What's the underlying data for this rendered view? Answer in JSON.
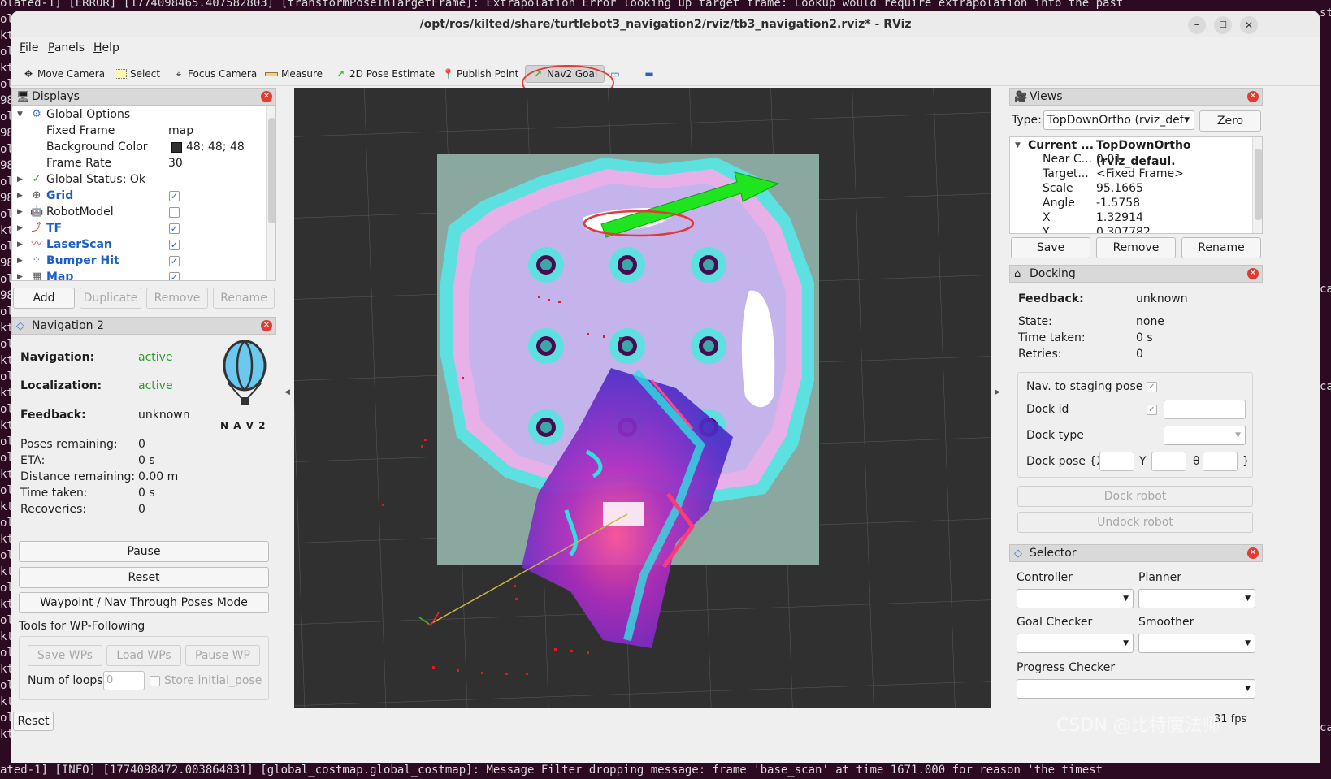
{
  "terminal": {
    "top_line": "olated-1] [ERROR] [1774098465.407582803] [transformPoseInTargetFrame]: Extrapolation Error looking up target frame: Lookup would require extrapolation into the past",
    "bottom_line": "ated-1] [INFO] [1774098472.003864831] [global_costmap.global_costmap]: Message Filter dropping message: frame 'base_scan' at time 1671.000 for reason 'the timest",
    "left_fragments": [
      "ol",
      "kt",
      "ol",
      "kt",
      "ol",
      "98",
      "ol",
      "98",
      "ol",
      "98",
      "ol",
      "98",
      "ol",
      "kt",
      "ol",
      "98",
      "ol",
      "98",
      "ol",
      "kt",
      "ol",
      "kt",
      "ol",
      "kt",
      "ol",
      "kt",
      "ol",
      "ol",
      "kt",
      "ol",
      "kt",
      "ol",
      "kt",
      "ol",
      "kt",
      "ol",
      "kt",
      "ol",
      "kt",
      "ol",
      "kt",
      "ol",
      "kt",
      "ol",
      "kt"
    ],
    "right_fragments": [
      "st",
      "",
      "",
      "",
      "",
      "",
      "",
      "",
      "",
      "",
      "",
      "",
      "",
      "",
      "",
      "",
      "",
      "ca",
      "",
      "",
      "",
      "",
      "",
      "ca",
      "",
      "",
      "",
      "",
      "",
      "",
      "",
      "",
      "",
      "",
      "",
      "",
      "",
      "",
      "",
      "",
      "",
      "",
      "",
      "",
      "ca"
    ]
  },
  "window": {
    "title": "/opt/ros/kilted/share/turtlebot3_navigation2/rviz/tb3_navigation2.rviz* - RViz",
    "controls": {
      "minimize": "–",
      "maximize": "☐",
      "close": "✕"
    }
  },
  "menu": [
    {
      "key": "F",
      "rest": "ile"
    },
    {
      "key": "P",
      "rest": "anels"
    },
    {
      "key": "H",
      "rest": "elp"
    }
  ],
  "toolbar": {
    "tools": [
      "Move Camera",
      "Select",
      "Focus Camera",
      "Measure",
      "2D Pose Estimate",
      "Publish Point",
      "Nav2 Goal"
    ],
    "active": "Nav2 Goal"
  },
  "displays": {
    "title": "Displays",
    "global_options": "Global Options",
    "fixed_frame": {
      "label": "Fixed Frame",
      "value": "map"
    },
    "background_color": {
      "label": "Background Color",
      "value": "48; 48; 48",
      "swatch": "#303030"
    },
    "frame_rate": {
      "label": "Frame Rate",
      "value": "30"
    },
    "global_status": "Global Status: Ok",
    "items": [
      {
        "name": "Grid",
        "checked": true,
        "highlight": true
      },
      {
        "name": "RobotModel",
        "checked": false,
        "highlight": false
      },
      {
        "name": "TF",
        "checked": true,
        "highlight": true
      },
      {
        "name": "LaserScan",
        "checked": true,
        "highlight": true
      },
      {
        "name": "Bumper Hit",
        "checked": true,
        "highlight": true
      },
      {
        "name": "Map",
        "checked": true,
        "highlight": true
      }
    ],
    "buttons": {
      "add": "Add",
      "duplicate": "Duplicate",
      "remove": "Remove",
      "rename": "Rename"
    }
  },
  "navigation2": {
    "title": "Navigation 2",
    "navigation": {
      "label": "Navigation:",
      "value": "active"
    },
    "localization": {
      "label": "Localization:",
      "value": "active"
    },
    "feedback": {
      "label": "Feedback:",
      "value": "unknown"
    },
    "logo_text": "N A V 2",
    "stats": [
      {
        "label": "Poses remaining:",
        "value": "0"
      },
      {
        "label": "ETA:",
        "value": "0 s"
      },
      {
        "label": "Distance remaining:",
        "value": "0.00 m"
      },
      {
        "label": "Time taken:",
        "value": "0 s"
      },
      {
        "label": "Recoveries:",
        "value": "0"
      }
    ],
    "buttons": {
      "pause": "Pause",
      "reset": "Reset",
      "waypoint_mode": "Waypoint / Nav Through Poses Mode"
    },
    "wp_title": "Tools for WP-Following",
    "wp_buttons": {
      "save": "Save WPs",
      "load": "Load WPs",
      "pause": "Pause WP"
    },
    "num_loops": {
      "label": "Num of loops",
      "value": "0"
    },
    "store_initial": "Store initial_pose"
  },
  "views": {
    "title": "Views",
    "type_label": "Type:",
    "type_value": "TopDownOrtho (rviz_def",
    "zero": "Zero",
    "current": {
      "label": "Current ...",
      "value": "TopDownOrtho (rviz_defaul."
    },
    "props": [
      {
        "label": "Near C...",
        "value": "0.01"
      },
      {
        "label": "Target...",
        "value": "<Fixed Frame>"
      },
      {
        "label": "Scale",
        "value": "95.1665"
      },
      {
        "label": "Angle",
        "value": "-1.5758"
      },
      {
        "label": "X",
        "value": "1.32914"
      },
      {
        "label": "Y",
        "value": "0.307782"
      }
    ],
    "buttons": {
      "save": "Save",
      "remove": "Remove",
      "rename": "Rename"
    }
  },
  "docking": {
    "title": "Docking",
    "feedback": {
      "label": "Feedback:",
      "value": "unknown"
    },
    "state": {
      "label": "State:",
      "value": "none"
    },
    "time_taken": {
      "label": "Time taken:",
      "value": "0 s"
    },
    "retries": {
      "label": "Retries:",
      "value": "0"
    },
    "nav_staging": "Nav. to staging pose",
    "dock_id": "Dock id",
    "dock_type": "Dock type",
    "dock_pose": {
      "label": "Dock pose {X",
      "y": "Y",
      "theta": "θ",
      "close": "}"
    },
    "dock_robot": "Dock robot",
    "undock_robot": "Undock robot"
  },
  "selector": {
    "title": "Selector",
    "labels": [
      "Controller",
      "Planner",
      "Goal Checker",
      "Smoother",
      "Progress Checker"
    ]
  },
  "statusbar": {
    "reset": "Reset",
    "fps": "31 fps"
  },
  "watermark": "CSDN @比特魔法师"
}
